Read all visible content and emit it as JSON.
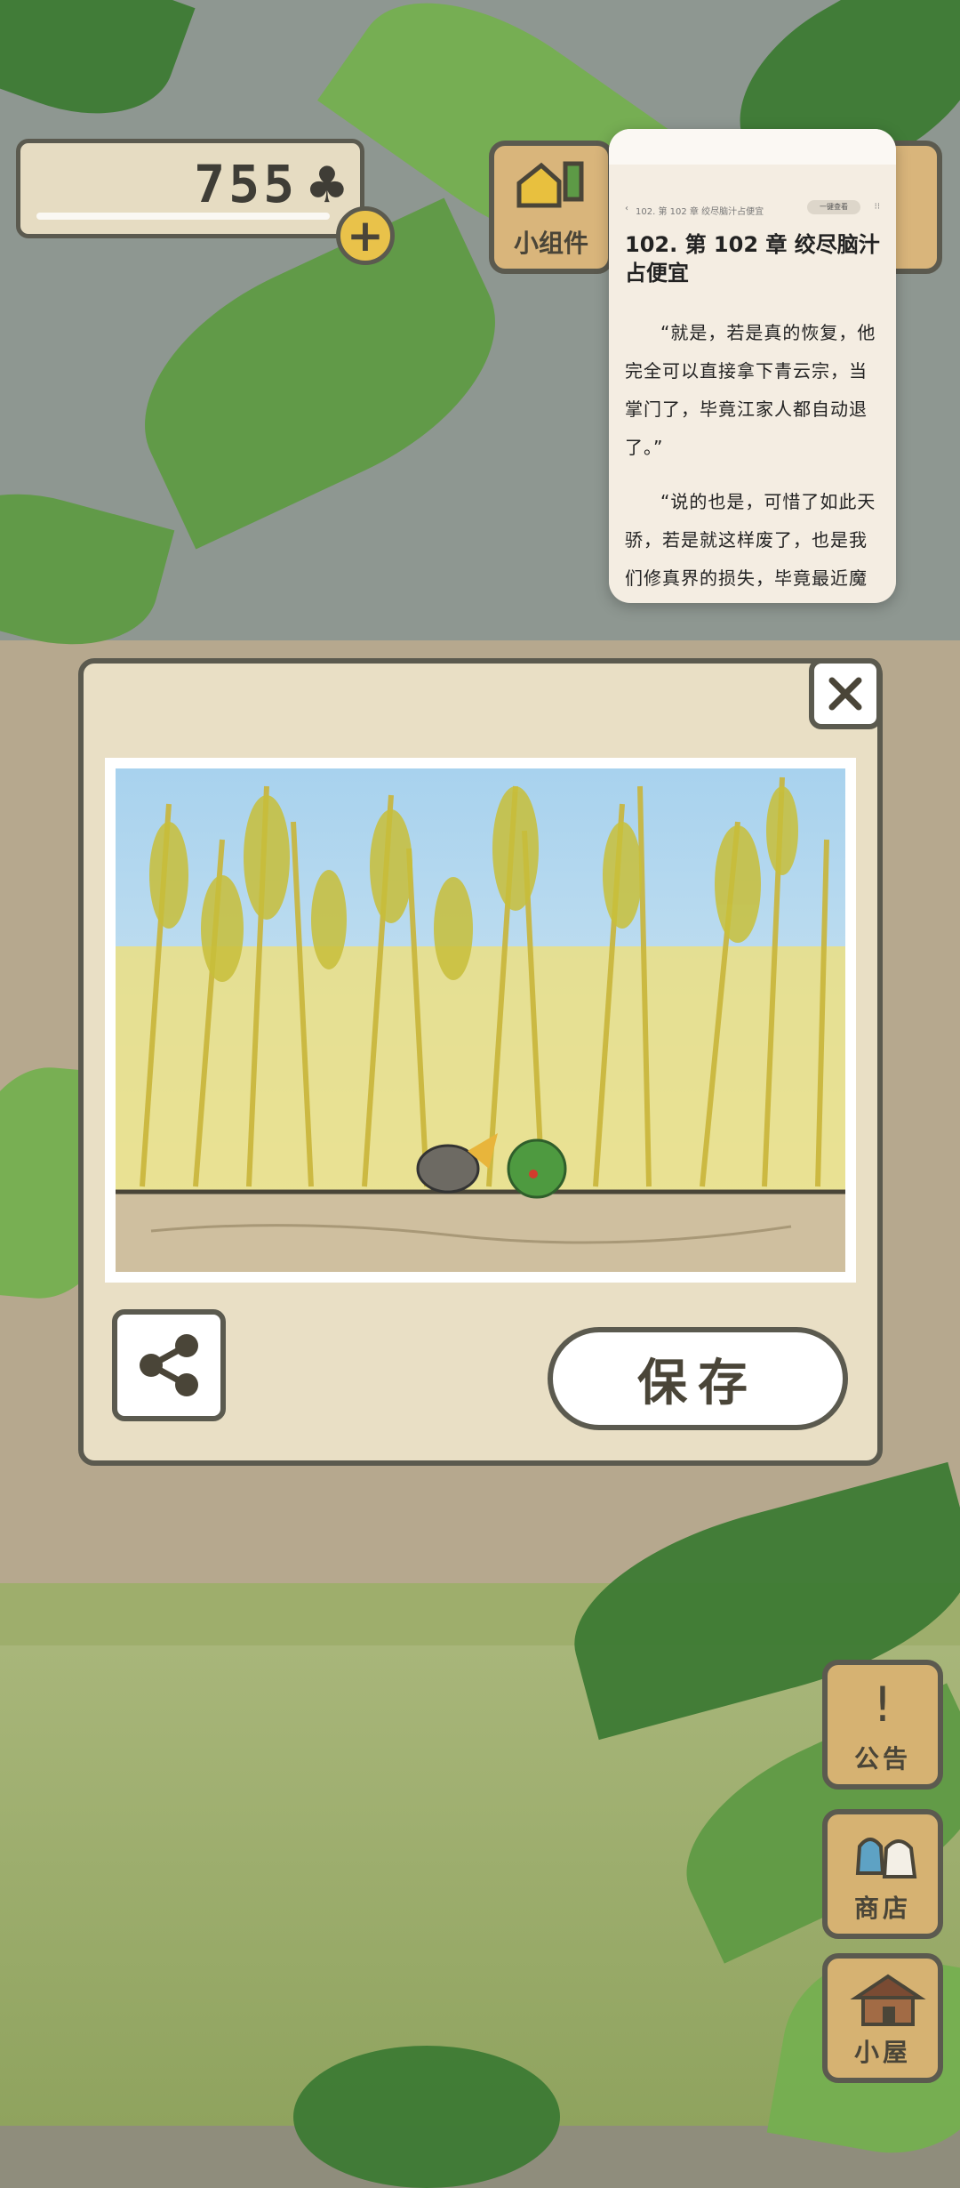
{
  "hud": {
    "clover_count": "755",
    "clover_icon": "club-icon",
    "add_label": "+"
  },
  "top_buttons": {
    "widget_label": "小组件"
  },
  "reader": {
    "nav_chapter": "102. 第 102 章 绞尽脑汁占便宜",
    "nav_pill": "一键查看",
    "chapter_title": "102. 第 102 章 绞尽脑汁占便宜",
    "paragraphs": [
      "“就是，若是真的恢复，他完全可以直接拿下青云宗，当掌门了，毕竟江家人都自动退了。”",
      "“说的也是，可惜了如此天骄，若是就这样废了，也是我们修真界的损失，毕竟最近魔修"
    ]
  },
  "photo_popup": {
    "close_icon": "close-icon",
    "share_icon": "share-icon",
    "save_label": "保存"
  },
  "side_menu": {
    "notice_label": "公告",
    "shop_label": "商店",
    "house_label": "小屋"
  }
}
